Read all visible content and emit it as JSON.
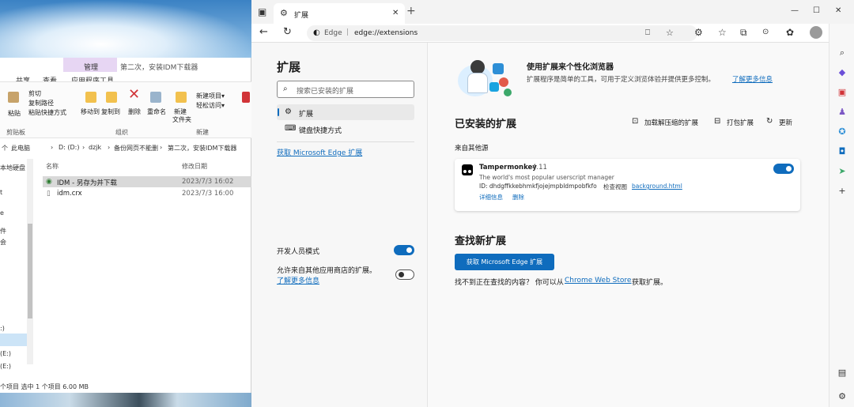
{
  "explorer": {
    "ribbon_tabs": [
      "共享",
      "查看",
      "应用程序工具"
    ],
    "manage_tab": "管理",
    "window_title": "第二次，安装IDM下载器",
    "ribbon_items": {
      "paste": "粘贴",
      "cut": "剪切",
      "copy_path": "复制路径",
      "paste_shortcut": "粘贴快捷方式",
      "move_to": "移动到",
      "copy_to": "复制到",
      "delete": "删除",
      "rename": "重命名",
      "new_folder_line1": "新建",
      "new_folder_line2": "文件夹",
      "new_item": "新建项目▾",
      "easy_access": "轻松访问▾"
    },
    "group_labels": {
      "clipboard": "剪贴板",
      "organize": "组织",
      "new": "新建"
    },
    "address_parts": [
      "个",
      "此电脑",
      "›",
      "D: (D:)",
      "›",
      "dzjk",
      "›",
      "备份网页不能删",
      "›",
      "第二次，安装IDM下载器"
    ],
    "nav_items": [
      "本地硬盘",
      "t",
      "e",
      "件",
      "会",
      ":)",
      "(E:)",
      "(E:)"
    ],
    "columns": {
      "name": "名称",
      "date": "修改日期"
    },
    "files": [
      {
        "name": "IDM - 另存为并下载",
        "date": "2023/7/3 16:02",
        "selected": true
      },
      {
        "name": "idm.crx",
        "date": "2023/7/3 16:00",
        "selected": false
      }
    ],
    "status": "个项目  选中 1 个项目  6.00 MB"
  },
  "edge": {
    "tab_title": "扩展",
    "url_prefix": "Edge",
    "url": "edge://extensions",
    "win_buttons": [
      "—",
      "☐",
      "✕"
    ],
    "left": {
      "heading": "扩展",
      "search_placeholder": "搜索已安装的扩展",
      "nav_extensions": "扩展",
      "nav_shortcuts": "键盘快捷方式",
      "get_link": "获取 Microsoft Edge 扩展",
      "dev_mode": "开发人员模式",
      "allow_other": "允许来自其他应用商店的扩展。",
      "more_info": "了解更多信息"
    },
    "right": {
      "promo_title": "使用扩展来个性化浏览器",
      "promo_text": "扩展程序是简单的工具，可用于定义浏览体验并提供更多控制。",
      "promo_link": "了解更多信息",
      "installed_heading": "已安装的扩展",
      "load_unpacked": "加载解压缩的扩展",
      "pack": "打包扩展",
      "update": "更新",
      "from_other": "来自其他源",
      "ext_name": "Tampermonkey",
      "ext_version": "4.11",
      "ext_desc": "The world's most popular userscript manager",
      "ext_id": "ID: dhdgffkkebhmkfjojejmpbldmpobfkfo",
      "inspect": "检查视图",
      "bg_page": "background.html",
      "details": "详细信息",
      "remove": "删除",
      "find_heading": "查找新扩展",
      "get_button": "获取 Microsoft Edge 扩展",
      "cant_find": "找不到正在查找的内容？ 你可以从",
      "store_link": "Chrome Web Store",
      "get_ext": "获取扩展。"
    }
  },
  "colors": {
    "accent": "#0f6cbd",
    "manage_tab": "#e7d6f3"
  }
}
